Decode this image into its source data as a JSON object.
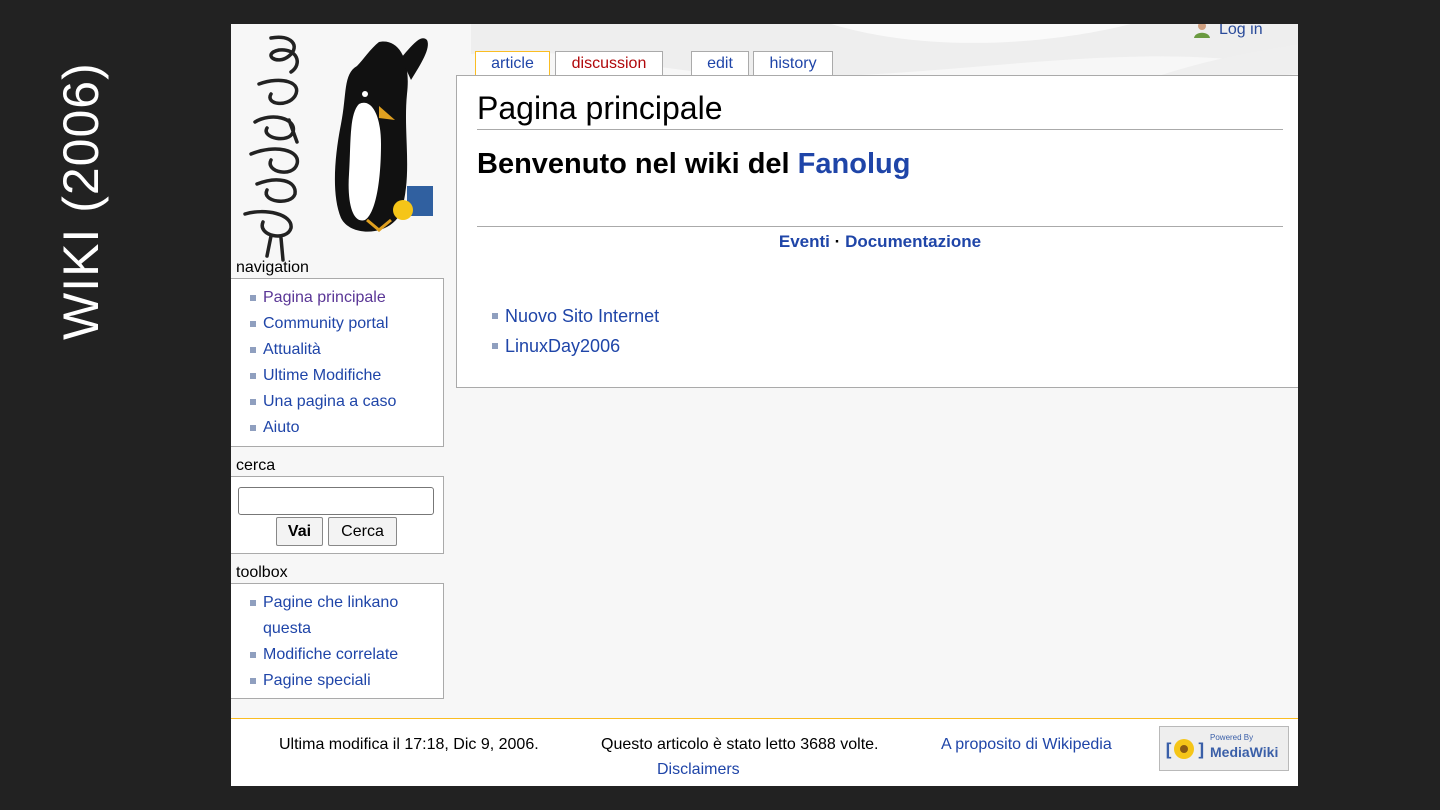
{
  "slide_caption": "WIKI (2006)",
  "logo": {
    "text": "fanolug"
  },
  "personal": {
    "login": "Log in"
  },
  "tabs": [
    {
      "label": "article"
    },
    {
      "label": "discussion"
    },
    {
      "label": "edit"
    },
    {
      "label": "history"
    }
  ],
  "content": {
    "title": "Pagina principale",
    "welcome_prefix": "Benvenuto nel wiki del ",
    "welcome_link": "Fanolug",
    "quicklinks": [
      "Eventi",
      "·",
      "Documentazione"
    ],
    "items": [
      "Nuovo Sito Internet",
      "LinuxDay2006"
    ]
  },
  "navigation": {
    "label": "navigation",
    "items": [
      "Pagina principale",
      "Community portal",
      "Attualità",
      "Ultime Modifiche",
      "Una pagina a caso",
      "Aiuto"
    ]
  },
  "search": {
    "label": "cerca",
    "value": "",
    "go_label": "Vai",
    "search_label": "Cerca"
  },
  "toolbox": {
    "label": "toolbox",
    "items": [
      "Pagine che linkano questa",
      "Modifiche correlate",
      "Pagine speciali"
    ]
  },
  "footer": {
    "last_modified": "Ultima modifica il 17:18, Dic 9, 2006.",
    "views": "Questo articolo è stato letto 3688 volte.",
    "about": "A proposito di Wikipedia",
    "disclaimers": "Disclaimers",
    "badge_small": "Powered By",
    "badge_big": "MediaWiki"
  },
  "colors": {
    "link": "#1f45a8",
    "visited": "#5a3696",
    "new_link": "#b0070a",
    "tab_selected": "#fabd23",
    "background": "#222222"
  }
}
